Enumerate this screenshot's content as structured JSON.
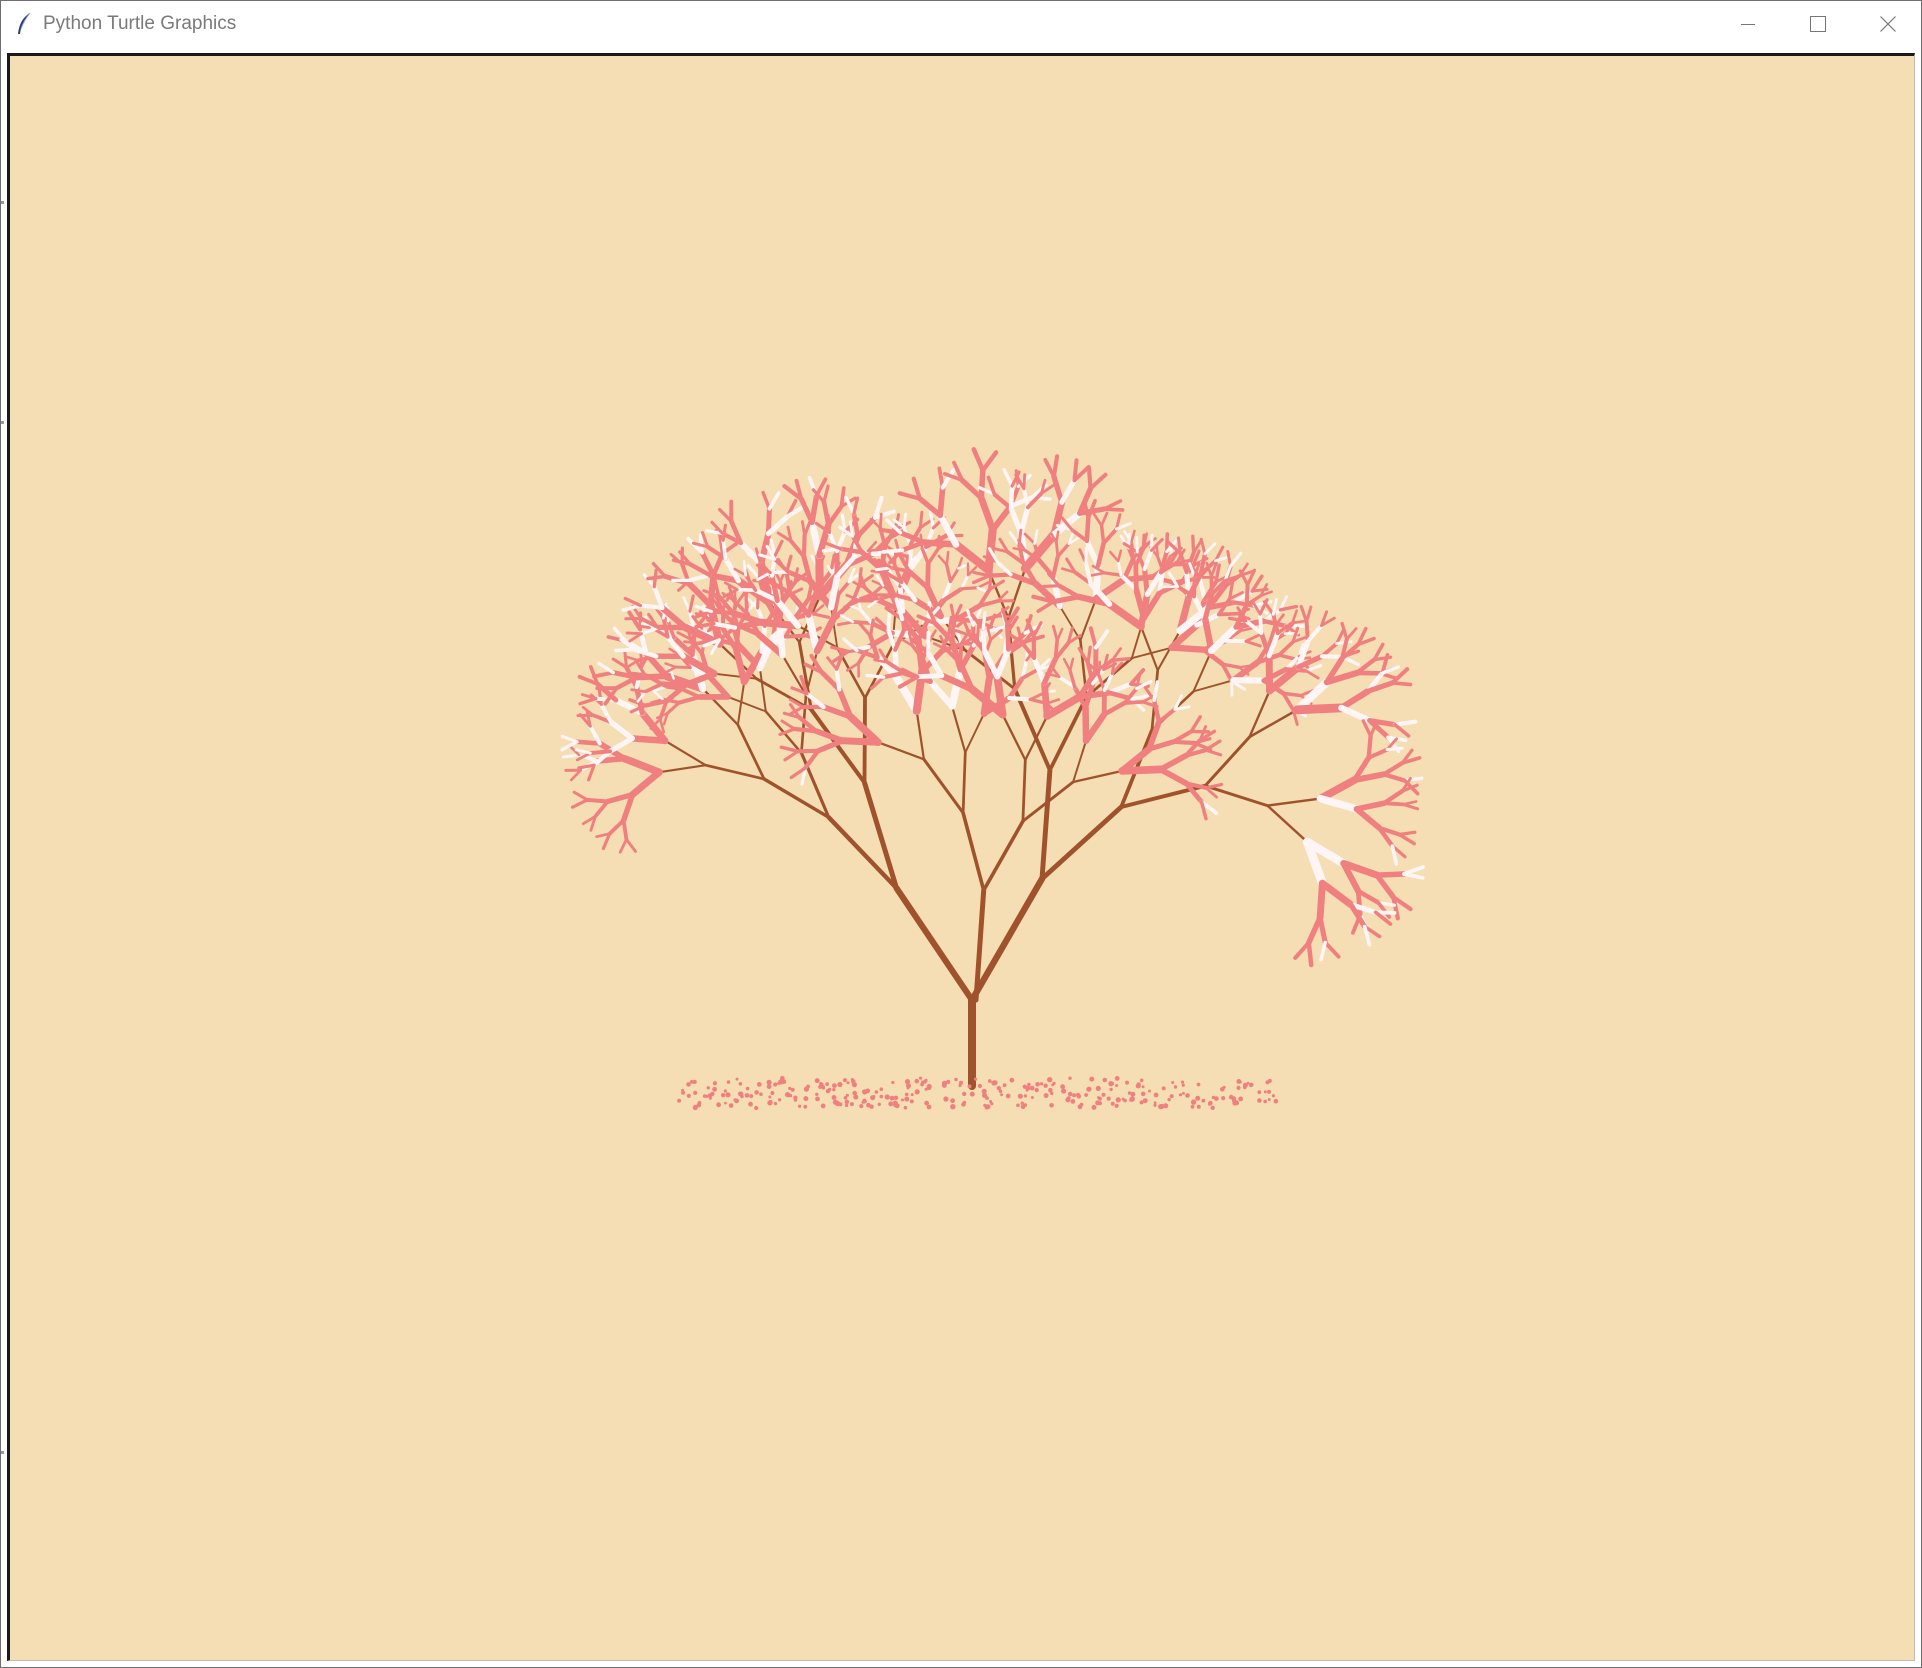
{
  "window": {
    "title": "Python Turtle Graphics",
    "app_icon": "feather-icon",
    "controls": {
      "minimize": "minimize-icon",
      "maximize": "maximize-icon",
      "close": "close-icon"
    }
  },
  "canvas": {
    "background": "#f5deb3",
    "trunk_color": "#a0522d",
    "blossom_colors": [
      "#f08080",
      "#fff5f5"
    ],
    "petal_color": "#f08080"
  }
}
